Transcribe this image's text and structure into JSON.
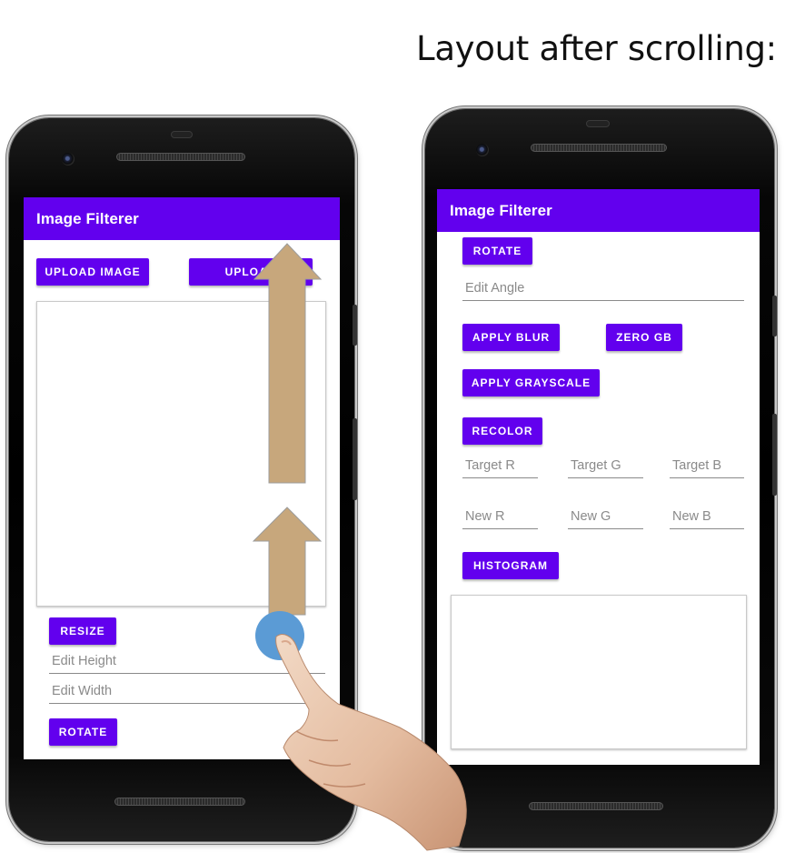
{
  "caption": "Layout after scrolling:",
  "colors": {
    "primary": "#6200ee",
    "arrow": "#c7a77c",
    "touch": "#5b9bd5"
  },
  "icons": {
    "camera": "front-camera-icon",
    "arrow": "up-arrow-icon",
    "hand": "pointing-hand-icon"
  },
  "left_screen": {
    "app_title": "Image Filterer",
    "upload_image_label": "UPLOAD IMAGE",
    "upload_second_label": "UPLOAD",
    "resize_label": "RESIZE",
    "edit_height_placeholder": "Edit Height",
    "edit_width_placeholder": "Edit Width",
    "rotate_label": "ROTATE"
  },
  "right_screen": {
    "app_title": "Image Filterer",
    "rotate_label": "ROTATE",
    "edit_angle_placeholder": "Edit Angle",
    "apply_blur_label": "APPLY BLUR",
    "zero_gb_label": "ZERO GB",
    "apply_grayscale_label": "APPLY GRAYSCALE",
    "recolor_label": "RECOLOR",
    "target_r_placeholder": "Target R",
    "target_g_placeholder": "Target G",
    "target_b_placeholder": "Target B",
    "new_r_placeholder": "New R",
    "new_g_placeholder": "New G",
    "new_b_placeholder": "New B",
    "histogram_label": "HISTOGRAM"
  }
}
